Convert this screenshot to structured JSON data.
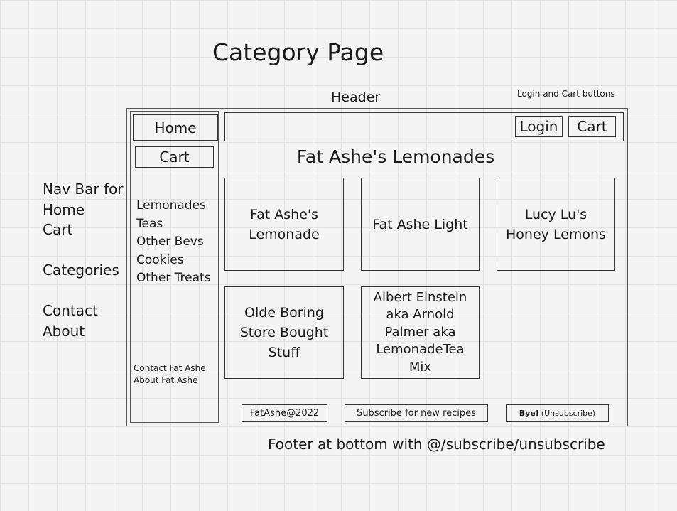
{
  "annotations": {
    "page_title": "Category Page",
    "header_note": "Header",
    "login_cart_note": "Login and Cart buttons",
    "footer_note": "Footer at bottom with @/subscribe/unsubscribe",
    "side_notes": {
      "line1": "Nav Bar for",
      "line2": "Home",
      "line3": "Cart",
      "line4": "Categories",
      "line5": "Contact",
      "line6": "About"
    }
  },
  "sidebar": {
    "home_label": "Home",
    "cart_label": "Cart",
    "categories": [
      "Lemonades",
      "Teas",
      "Other Bevs",
      "Cookies",
      "Other Treats"
    ],
    "contact_label": "Contact Fat Ashe",
    "about_label": "About Fat Ashe"
  },
  "header": {
    "login_label": "Login",
    "cart_label": "Cart"
  },
  "main": {
    "title": "Fat Ashe's Lemonades",
    "products": [
      "Fat Ashe's Lemonade",
      "Fat Ashe Light",
      "Lucy Lu's Honey Lemons",
      "Olde Boring Store Bought Stuff",
      "Albert Einstein aka Arnold Palmer aka LemonadeTea Mix"
    ]
  },
  "footer": {
    "copyright": "FatAshe@2022",
    "subscribe_label": "Subscribe for new recipes",
    "bye_label": "Bye!",
    "unsubscribe_label": "(Unsubscribe)"
  }
}
